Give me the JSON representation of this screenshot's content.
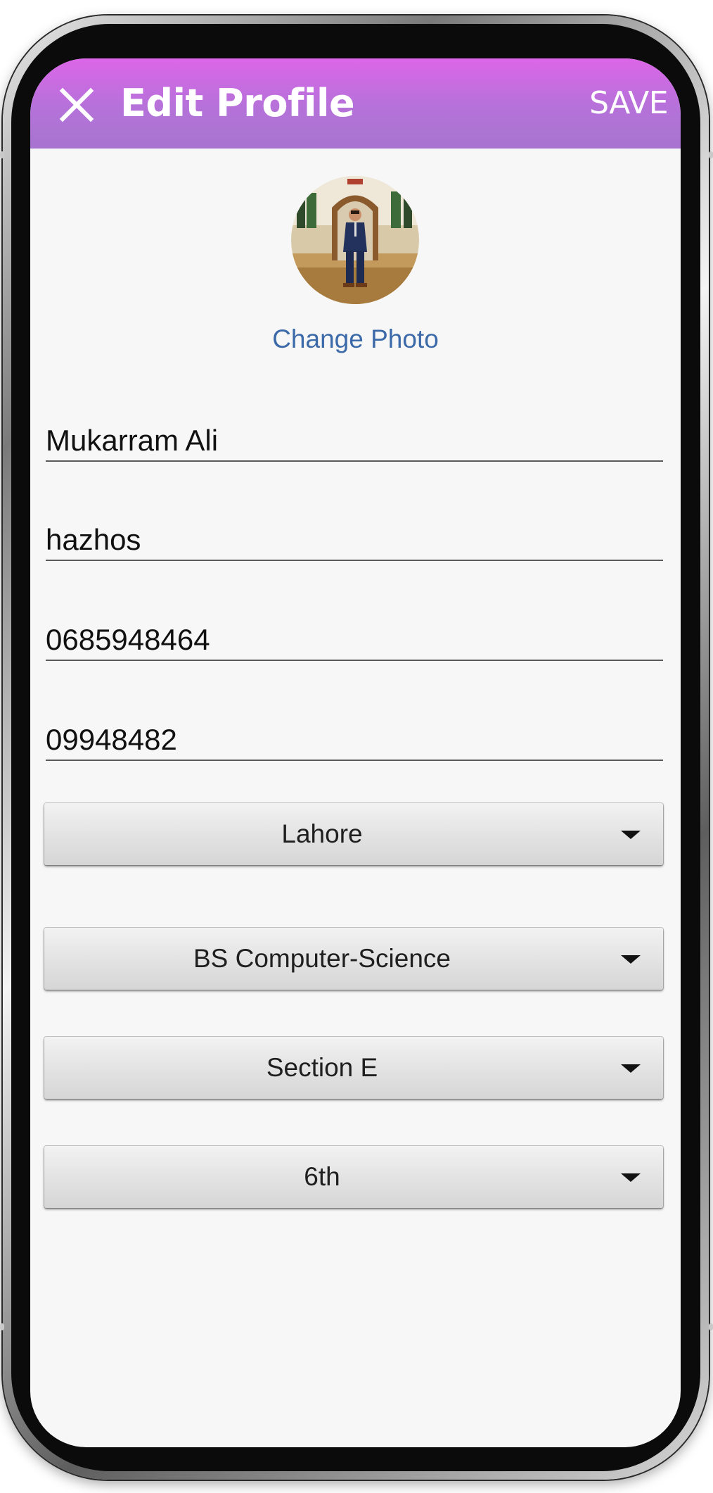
{
  "header": {
    "title": "Edit Profile",
    "save_label": "SAVE",
    "close_icon": "close-icon",
    "background_gradient": [
      "#dc66e8",
      "#a675cf"
    ]
  },
  "profile": {
    "change_photo_label": "Change Photo",
    "avatar_icon": "avatar-photo"
  },
  "fields": {
    "name": "Mukarram Ali",
    "username": "hazhos",
    "phone": "0685948464",
    "roll_number": "09948482"
  },
  "dropdowns": {
    "city": "Lahore",
    "program": "BS Computer-Science",
    "section": "Section E",
    "semester": "6th",
    "arrow_icon": "dropdown-arrow-icon"
  },
  "colors": {
    "link": "#3c6aa8",
    "background": "#f7f7f7"
  }
}
